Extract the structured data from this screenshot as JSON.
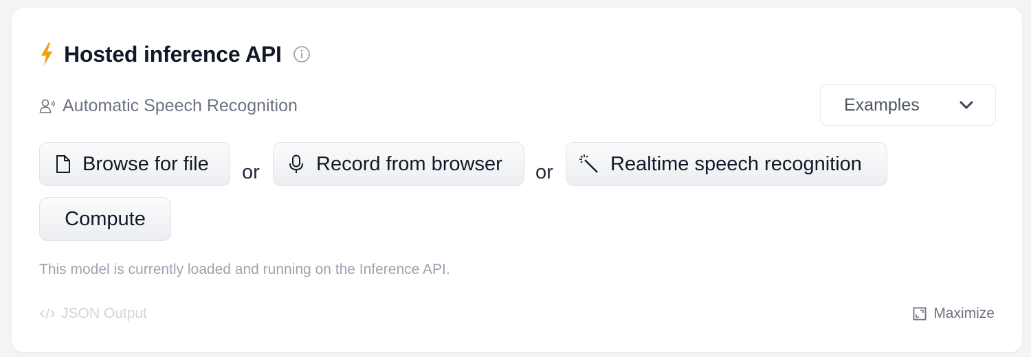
{
  "widget": {
    "title": "Hosted inference API",
    "task": "Automatic Speech Recognition",
    "examples_label": "Examples",
    "actions": {
      "browse_label": "Browse for file",
      "separator_1": "or",
      "record_label": "Record from browser",
      "separator_2": "or",
      "realtime_label": "Realtime speech recognition"
    },
    "compute_label": "Compute",
    "status_text": "This model is currently loaded and running on the Inference API.",
    "json_output_label": "JSON Output",
    "maximize_label": "Maximize"
  },
  "icons": {
    "bolt": "lightning-bolt-icon",
    "info": "info-icon",
    "task": "user-voice-icon",
    "chevron": "chevron-down-icon",
    "file": "file-icon",
    "mic": "microphone-icon",
    "wand": "magic-wand-icon",
    "code": "code-icon",
    "maximize": "maximize-icon"
  },
  "colors": {
    "accent": "#f59e0b",
    "text_primary": "#111827",
    "text_muted": "#6b7280",
    "disabled": "#d1d5db"
  }
}
